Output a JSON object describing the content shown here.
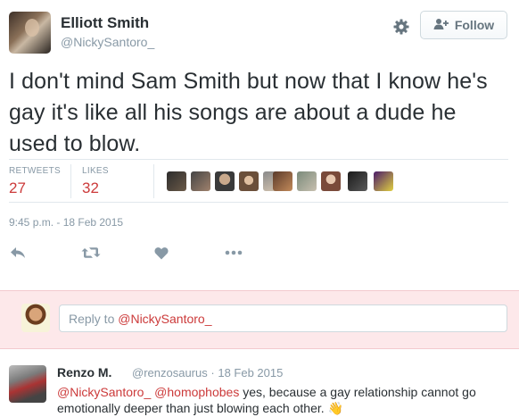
{
  "tweet": {
    "author_name": "Elliott Smith",
    "author_handle": "@NickySantoro_",
    "text": "I don't mind Sam Smith but now that I know he's gay it's like all his songs are about a dude he used to blow.",
    "timestamp": "9:45 p.m. - 18 Feb 2015"
  },
  "follow": {
    "label": "Follow"
  },
  "stats": {
    "retweets_label": "RETWEETS",
    "retweets_value": "27",
    "likes_label": "LIKES",
    "likes_value": "32"
  },
  "likers": {
    "count": 10
  },
  "actions": [
    "reply-icon",
    "retweet-icon",
    "like-icon",
    "more-icon"
  ],
  "reply_box": {
    "prefix": "Reply to ",
    "mention": "@NickySantoro_"
  },
  "reply": {
    "author_name": "Renzo M.",
    "author_handle": "@renzosaurus",
    "separator": "·",
    "date": "18 Feb 2015",
    "mention1": "@NickySantoro_",
    "mention2": "@homophobes",
    "text": " yes, because a gay relationship cannot go emotionally deeper than just blowing each other.",
    "emoji": "👋"
  },
  "colors": {
    "accent": "#cc3a3a",
    "muted": "#8899a6",
    "band": "#fde8ea"
  }
}
